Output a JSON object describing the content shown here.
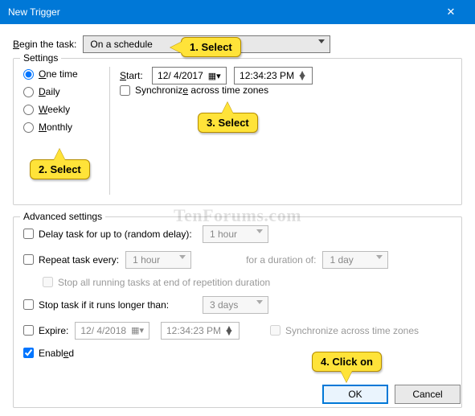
{
  "window": {
    "title": "New Trigger",
    "close": "✕"
  },
  "begin": {
    "label": "Begin the task:",
    "value": "On a schedule"
  },
  "settings": {
    "legend": "Settings",
    "radios": {
      "one": "One time",
      "daily": "Daily",
      "weekly": "Weekly",
      "monthly": "Monthly"
    },
    "start_label": "Start:",
    "start_date": "12/ 4/2017",
    "start_time": "12:34:23 PM",
    "sync_label": "Synchronize across time zones"
  },
  "advanced": {
    "legend": "Advanced settings",
    "delay_label": "Delay task for up to (random delay):",
    "delay_value": "1 hour",
    "repeat_label": "Repeat task every:",
    "repeat_value": "1 hour",
    "duration_label": "for a duration of:",
    "duration_value": "1 day",
    "stop_all_label": "Stop all running tasks at end of repetition duration",
    "stop_if_label": "Stop task if it runs longer than:",
    "stop_if_value": "3 days",
    "expire_label": "Expire:",
    "expire_date": "12/ 4/2018",
    "expire_time": "12:34:23 PM",
    "sync_label2": "Synchronize across time zones",
    "enabled_label": "Enabled"
  },
  "buttons": {
    "ok": "OK",
    "cancel": "Cancel"
  },
  "callouts": {
    "c1": "1. Select",
    "c2": "2. Select",
    "c3": "3. Select",
    "c4": "4. Click on"
  },
  "watermark": "TenForums.com"
}
